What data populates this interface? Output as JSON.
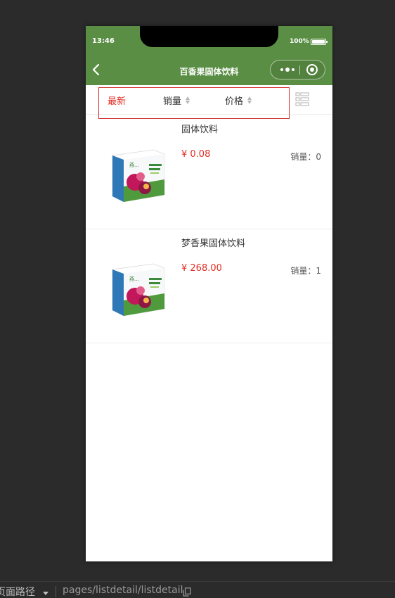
{
  "status_bar": {
    "time": "13:46",
    "battery": "100%"
  },
  "nav": {
    "title": "百香果固体饮料"
  },
  "sort_bar": {
    "items": [
      {
        "label": "最新",
        "active": true
      },
      {
        "label": "销量",
        "active": false
      },
      {
        "label": "价格",
        "active": false
      }
    ]
  },
  "products": [
    {
      "name": "固体饮料",
      "price": "¥ 0.08",
      "sales": "销量：0"
    },
    {
      "name": "梦香果固体饮料",
      "price": "¥ 268.00",
      "sales": "销量：1"
    }
  ],
  "devtools": {
    "path_label": "页面路径",
    "path": "pages/listdetail/listdetail"
  },
  "colors": {
    "header": "#5a8e44",
    "active": "#e02e24",
    "price": "#e02e24"
  }
}
